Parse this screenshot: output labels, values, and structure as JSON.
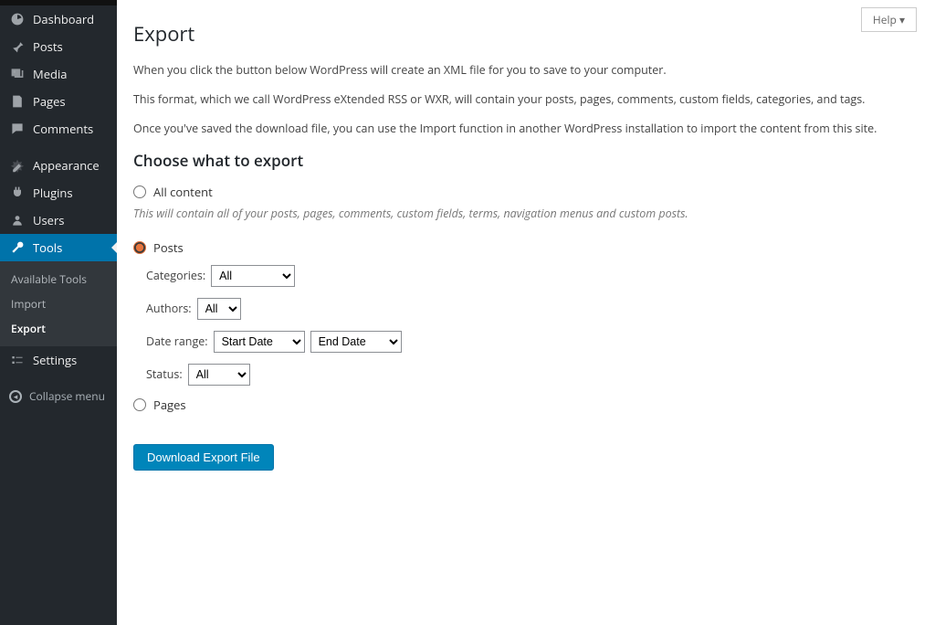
{
  "sidebar": {
    "items": [
      {
        "label": "Dashboard",
        "icon": "dashboard-icon"
      },
      {
        "label": "Posts",
        "icon": "pin-icon"
      },
      {
        "label": "Media",
        "icon": "media-icon"
      },
      {
        "label": "Pages",
        "icon": "pages-icon"
      },
      {
        "label": "Comments",
        "icon": "comments-icon"
      },
      {
        "label": "Appearance",
        "icon": "appearance-icon"
      },
      {
        "label": "Plugins",
        "icon": "plugins-icon"
      },
      {
        "label": "Users",
        "icon": "users-icon"
      },
      {
        "label": "Tools",
        "icon": "tools-icon",
        "current": true
      },
      {
        "label": "Settings",
        "icon": "settings-icon"
      }
    ],
    "submenu": {
      "items": [
        {
          "label": "Available Tools"
        },
        {
          "label": "Import"
        },
        {
          "label": "Export",
          "active": true
        }
      ]
    },
    "collapse_label": "Collapse menu"
  },
  "help_tab": "Help ▾",
  "page_title": "Export",
  "intro": {
    "p1": "When you click the button below WordPress will create an XML file for you to save to your computer.",
    "p2": "This format, which we call WordPress eXtended RSS or WXR, will contain your posts, pages, comments, custom fields, categories, and tags.",
    "p3": "Once you've saved the download file, you can use the Import function in another WordPress installation to import the content from this site."
  },
  "section_title": "Choose what to export",
  "options": {
    "all_content_label": "All content",
    "all_content_desc": "This will contain all of your posts, pages, comments, custom fields, terms, navigation menus and custom posts.",
    "posts_label": "Posts",
    "pages_label": "Pages"
  },
  "fields": {
    "categories_label": "Categories:",
    "categories_value": "All",
    "authors_label": "Authors:",
    "authors_value": "All",
    "date_range_label": "Date range:",
    "start_date_value": "Start Date",
    "end_date_value": "End Date",
    "status_label": "Status:",
    "status_value": "All"
  },
  "download_button": "Download Export File"
}
